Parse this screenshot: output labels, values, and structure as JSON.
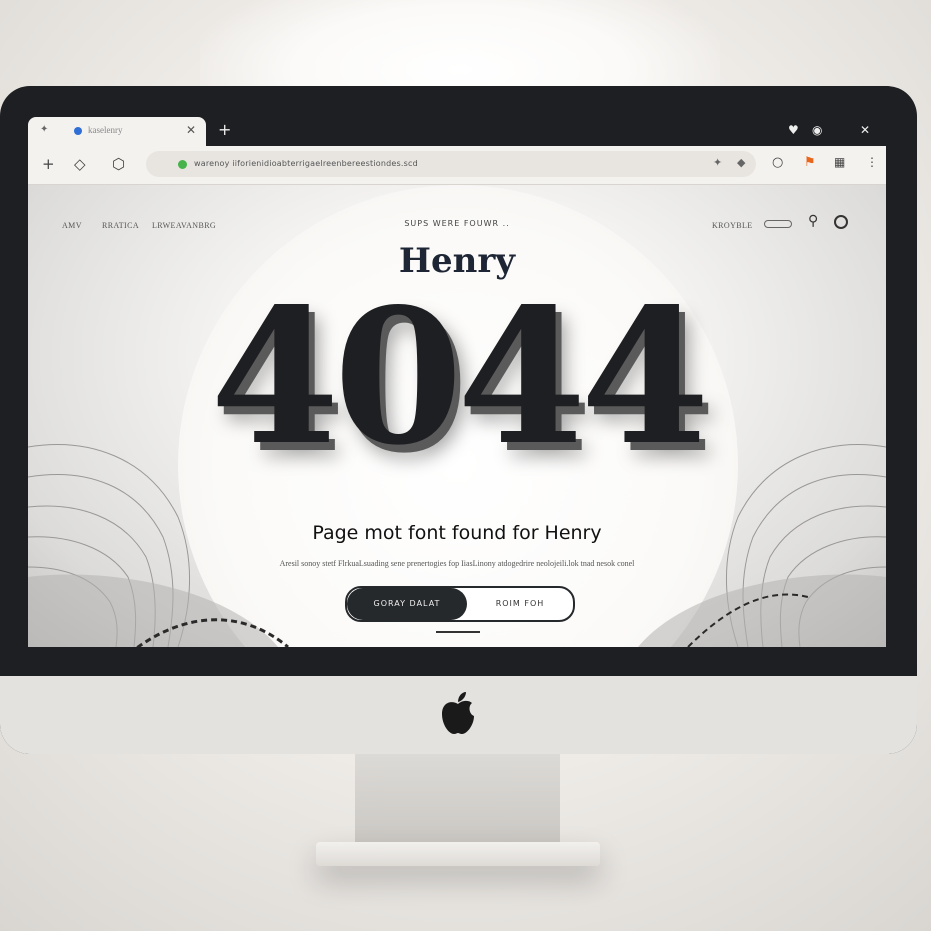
{
  "browser": {
    "tab_title": "kaselenry",
    "url": "warenoy iiforienidioabterrigaelreenbereestiondes.scd"
  },
  "site": {
    "nav_left": [
      "AMV",
      "RRATICA",
      "LRWEAVANBRG"
    ],
    "nav_right": [
      "KROYBLE"
    ],
    "small_heading": "SUPS WERE FOUWR ..",
    "brand": "Henry",
    "error_code": "4044",
    "headline": "Page mot font found for Henry",
    "subtext": "Aresil sonoy stetf FlrkuaLsuading sene prenertogies fop IiasLinony atdogedrire neolojeili.lok tnad nesok conel",
    "primary_button": "GORAY DALAT",
    "secondary_button": "ROIM FOH"
  },
  "colors": {
    "accent_dark": "#26292c",
    "brand_color": "#1e2636",
    "secure_dot": "#47b34a",
    "favicon": "#2f6fd6",
    "toolbar_icon_orange": "#e8671c"
  }
}
